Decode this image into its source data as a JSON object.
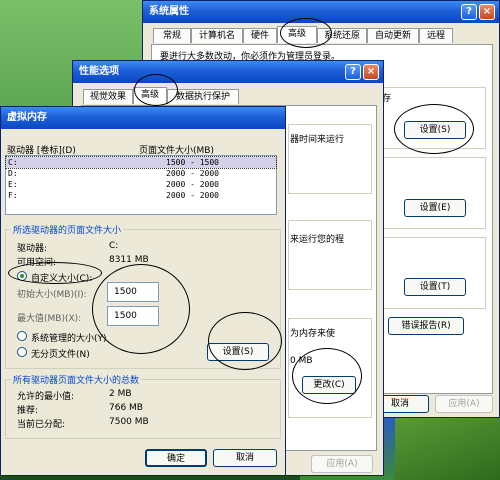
{
  "win_sys": {
    "title": "系统属性",
    "tabs": [
      "常规",
      "计算机名",
      "硬件",
      "高级",
      "系统还原",
      "自动更新",
      "远程"
    ],
    "notice": "要进行大多数改动，你必须作为管理员登录。",
    "right_frag_1": "存",
    "btn_settings_1": "设置(S)",
    "btn_settings_2": "设置(E)",
    "btn_settings_3": "设置(T)",
    "btn_error_report": "错误报告(R)",
    "btn_cancel": "取消",
    "btn_apply": "应用(A)"
  },
  "win_perf": {
    "title": "性能选项",
    "tabs": [
      "视觉效果",
      "高级",
      "数据执行保护"
    ],
    "frag_time": "器时间来运行",
    "frag_run": "来运行您的程",
    "frag_mem": "为内存来使",
    "frag_mb": "0 MB",
    "btn_change": "更改(C)",
    "btn_apply": "应用(A)"
  },
  "win_vm": {
    "title": "虚拟内存",
    "col_drive": "驱动器 [卷标](D)",
    "col_size": "页面文件大小(MB)",
    "drives": [
      {
        "name": "C:",
        "size": "1500 - 1500"
      },
      {
        "name": "D:",
        "size": "2000 - 2000"
      },
      {
        "name": "E:",
        "size": "2000 - 2000"
      },
      {
        "name": "F:",
        "size": "2000 - 2000"
      }
    ],
    "group_selected": "所选驱动器的页面文件大小",
    "label_drive": "驱动器:",
    "val_drive": "C:",
    "label_free": "可用空间:",
    "val_free": "8311 MB",
    "radio_custom": "自定义大小(C):",
    "label_initial": "初始大小(MB)(I):",
    "val_initial": "1500",
    "label_max": "最大值(MB)(X):",
    "val_max": "1500",
    "radio_system": "系统管理的大小(Y)",
    "radio_none": "无分页文件(N)",
    "btn_set": "设置(S)",
    "group_total": "所有驱动器页面文件大小的总数",
    "label_min": "允许的最小值:",
    "val_min": "2 MB",
    "label_rec": "推荐:",
    "val_rec": "766 MB",
    "label_cur": "当前已分配:",
    "val_cur": "7500 MB",
    "btn_ok": "确定",
    "btn_cancel": "取消"
  }
}
